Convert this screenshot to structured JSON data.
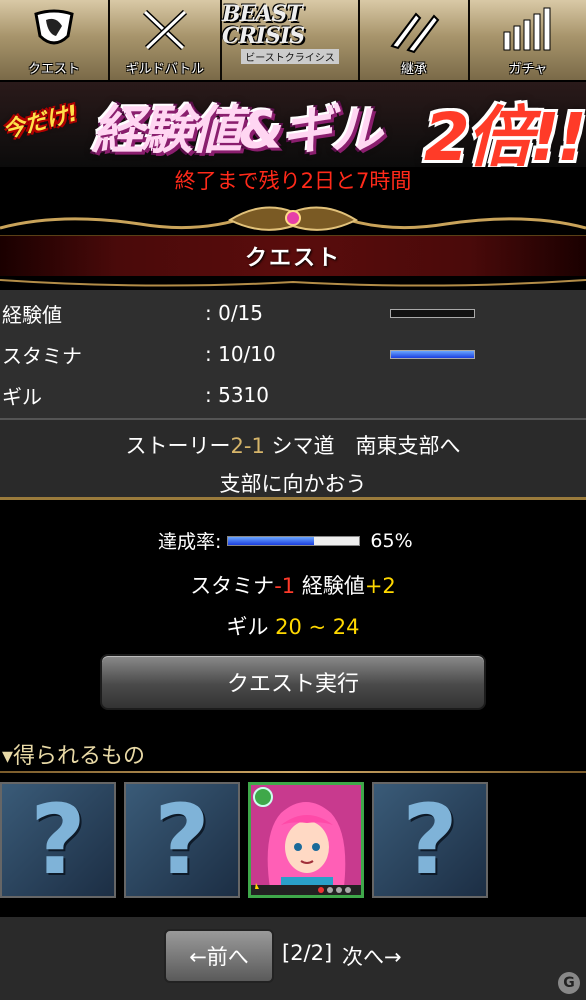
{
  "nav": {
    "items": [
      {
        "label": "クエスト",
        "icon": "shield-horse-icon"
      },
      {
        "label": "ギルドバトル",
        "icon": "crossed-swords-icon"
      },
      {
        "label": "ビーストクライシス",
        "icon": "beast-crisis-logo"
      },
      {
        "label": "継承",
        "icon": "feather-arrows-icon"
      },
      {
        "label": "ガチャ",
        "icon": "bars-icon"
      }
    ],
    "logo_text": "BEAST CRISIS"
  },
  "banner": {
    "left": "今だけ!",
    "main": "経験値&ギル",
    "right": "2倍!!"
  },
  "countdown": "終了まで残り2日と7時間",
  "title": "クエスト",
  "stats": {
    "exp_label": "経験値",
    "exp_value": ": 0/15",
    "exp_fill": 0,
    "stamina_label": "スタミナ",
    "stamina_value": ": 10/10",
    "stamina_fill": 1,
    "gil_label": "ギル",
    "gil_value": ": 5310"
  },
  "story": {
    "prefix": "ストーリー",
    "chapter": "2-1",
    "suffix": " シマ道　南東支部へ",
    "objective": "支部に向かおう"
  },
  "quest": {
    "achievement_label": "達成率:",
    "achievement_value": "65%",
    "achievement_fill": 0.65,
    "stamina_label": "スタミナ",
    "stamina_cost": "-1",
    "exp_label": " 経験値",
    "exp_gain": "+2",
    "gil_label": "ギル ",
    "gil_range": "20 ~ 24",
    "execute_label": "クエスト実行"
  },
  "rewards": {
    "title": "▾得られるもの",
    "items": [
      {
        "type": "unknown",
        "glyph": "?"
      },
      {
        "type": "unknown",
        "glyph": "?"
      },
      {
        "type": "card"
      },
      {
        "type": "unknown",
        "glyph": "?"
      }
    ]
  },
  "pager": {
    "prev_label": "←前へ",
    "page": "[2/2]",
    "next_label": "次へ→"
  },
  "watermark": "G",
  "colors": {
    "accent_red": "#ff2a1a",
    "highlight_yellow": "#ffd800",
    "gold": "#d6b56a",
    "bar_blue": "#1b3fe0"
  }
}
